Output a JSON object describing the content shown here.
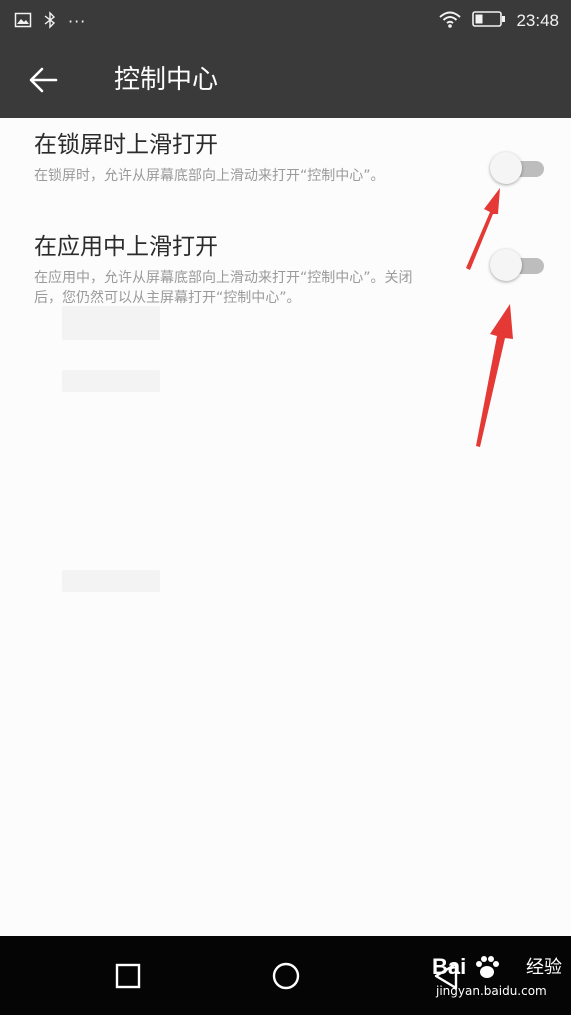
{
  "statusbar": {
    "left_icons": [
      "image-icon",
      "bluetooth-icon",
      "more-dots-icon"
    ],
    "dots": "···",
    "right_icons": [
      "wifi-icon",
      "battery-icon"
    ],
    "time": "23:48"
  },
  "appbar": {
    "back_icon": "arrow-left-icon",
    "title": "控制中心"
  },
  "settings": [
    {
      "title": "在锁屏时上滑打开",
      "description": "在锁屏时，允许从屏幕底部向上滑动来打开“控制中心”。",
      "enabled": false
    },
    {
      "title": "在应用中上滑打开",
      "description": "在应用中，允许从屏幕底部向上滑动来打开“控制中心”。关闭后，您仍然可以从主屏幕打开“控制中心”。",
      "enabled": false
    }
  ],
  "annotations": {
    "arrow_color": "#e53935"
  },
  "navbar": {
    "buttons": [
      "recent-apps-icon",
      "home-icon",
      "back-triangle-icon"
    ]
  },
  "watermark": {
    "brand": "Bai",
    "sub": "经验",
    "url": "jingyan.baidu.com"
  },
  "colors": {
    "bar_background": "#3a3a3a",
    "toggle_off_track": "#bdbdbd",
    "navbar_background": "#050505"
  }
}
